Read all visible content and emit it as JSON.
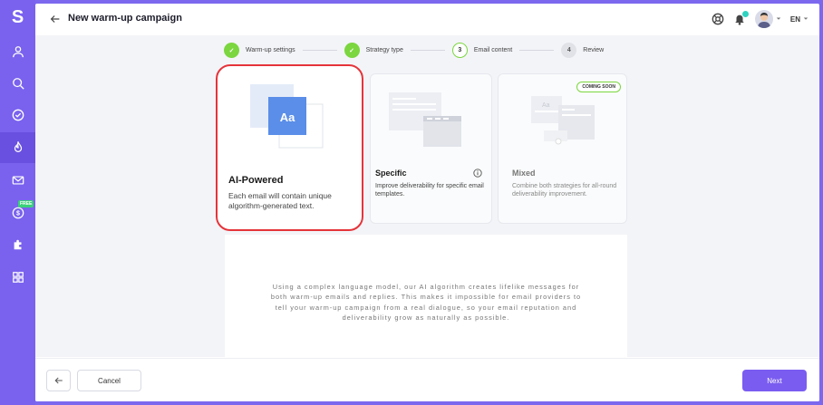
{
  "brand": {
    "logo": "S",
    "accent": "#7a62ee",
    "success": "#7bd63f",
    "highlight": "#e5343a"
  },
  "sidebar": {
    "items": [
      {
        "icon": "user-icon"
      },
      {
        "icon": "search-icon"
      },
      {
        "icon": "check-circle-icon"
      },
      {
        "icon": "fire-icon",
        "active": true
      },
      {
        "icon": "mail-icon"
      },
      {
        "icon": "dollar-icon",
        "badge": "FREE"
      },
      {
        "icon": "puzzle-icon"
      },
      {
        "icon": "grid-icon"
      }
    ]
  },
  "header": {
    "title": "New warm-up campaign",
    "language": "EN"
  },
  "stepper": {
    "steps": [
      {
        "number": "✓",
        "label": "Warm-up settings",
        "state": "done"
      },
      {
        "number": "✓",
        "label": "Strategy type",
        "state": "done"
      },
      {
        "number": "3",
        "label": "Email content",
        "state": "current"
      },
      {
        "number": "4",
        "label": "Review",
        "state": "todo"
      }
    ]
  },
  "cards": {
    "ai": {
      "title": "AI-Powered",
      "description": "Each email will contain unique algorithm-generated text.",
      "icon_text": "Aa"
    },
    "specific": {
      "title": "Specific",
      "description": "Improve deliverability for specific email templates."
    },
    "mixed": {
      "title": "Mixed",
      "description": "Combine both strategies for all-round deliverability improvement.",
      "badge": "COMING SOON"
    }
  },
  "description": "Using a complex language model, our AI algorithm creates lifelike messages for both warm-up emails and replies. This makes it impossible for email providers to tell your warm-up campaign from a real dialogue, so your email reputation and deliverability grow as naturally as possible.",
  "footer": {
    "cancel_label": "Cancel",
    "next_label": "Next"
  }
}
